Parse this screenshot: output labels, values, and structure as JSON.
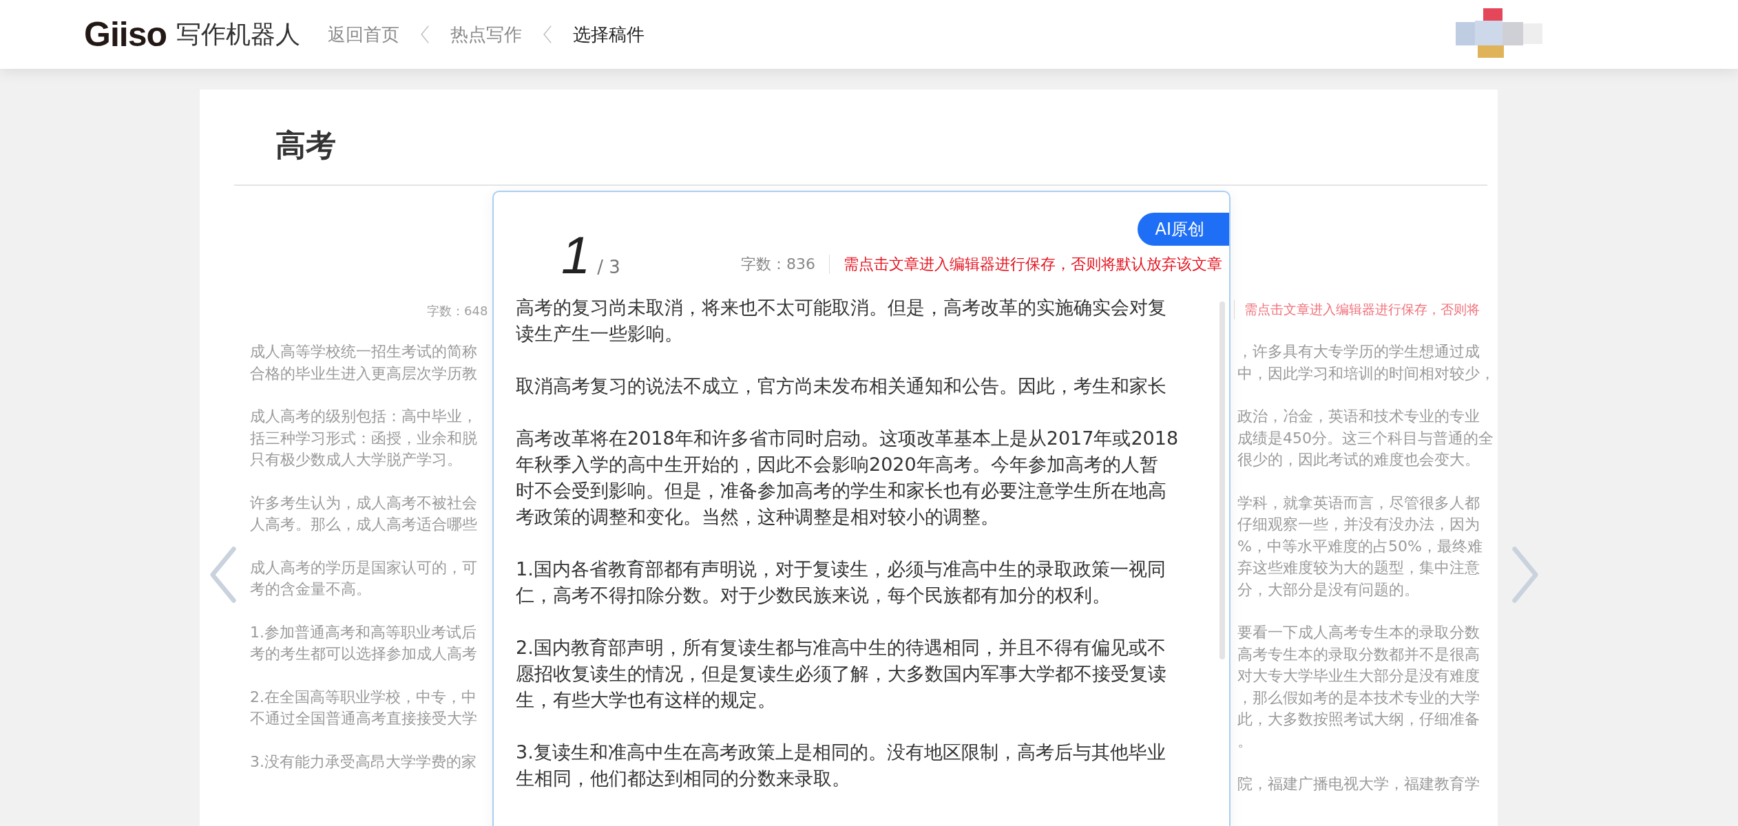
{
  "header": {
    "logo": "Giiso",
    "product": "写作机器人",
    "breadcrumbs": [
      {
        "label": "返回首页",
        "current": false
      },
      {
        "label": "热点写作",
        "current": false
      },
      {
        "label": "选择稿件",
        "current": true
      }
    ]
  },
  "background_article": {
    "title": "高考",
    "word_count": "字数：648",
    "notice": "需点击文章进入编辑器进行保存，否则将",
    "left_paragraphs": [
      [
        "成人高等学校统一招生考试的简称",
        "合格的毕业生进入更高层次学历教"
      ],
      [
        "成人高考的级别包括：高中毕业，",
        "括三种学习形式：函授，业余和脱",
        "只有极少数成人大学脱产学习。"
      ],
      [
        "许多考生认为，成人高考不被社会",
        "人高考。那么，成人高考适合哪些"
      ],
      [
        "成人高考的学历是国家认可的，可",
        "考的含金量不高。"
      ],
      [
        "1.参加普通高考和高等职业考试后",
        "考的考生都可以选择参加成人高考"
      ],
      [
        "2.在全国高等职业学校，中专，中",
        "不通过全国普通高考直接接受大学"
      ],
      [
        "3.没有能力承受高昂大学学费的家"
      ]
    ],
    "right_paragraphs": [
      [
        "，许多具有大专学历的学生想通过成",
        "中，因此学习和培训的时间相对较少，"
      ],
      [
        "政治，冶金，英语和技术专业的专业",
        "成绩是450分。这三个科目与普通的全",
        "很少的，因此考试的难度也会变大。"
      ],
      [
        "学科，就拿英语而言，尽管很多人都",
        "仔细观察一些，并没有没办法，因为",
        "%，中等水平难度的占50%，最终难",
        "弃这些难度较为大的题型，集中注意",
        "分，大部分是没有问题的。"
      ],
      [
        "要看一下成人高考专生本的录取分数",
        "高考专生本的录取分数都并不是很高",
        "对大专大学毕业生大部分是没有难度",
        "，那么假如考的是本技术专业的大学",
        "此，大多数按照考试大纲，仔细准备",
        "。"
      ],
      [
        "院，福建广播电视大学，福建教育学"
      ]
    ]
  },
  "draft_card": {
    "index": "1",
    "total": "/ 3",
    "badge": "AI原创",
    "word_count": "字数：836",
    "notice": "需点击文章进入编辑器进行保存，否则将默认放弃该文章",
    "paragraphs": [
      [
        "高考的复习尚未取消，将来也不太可能取消。但是，高考改革的实施确实会对复",
        "读生产生一些影响。"
      ],
      [
        "取消高考复习的说法不成立，官方尚未发布相关通知和公告。因此，考生和家长"
      ],
      [
        "高考改革将在2018年和许多省市同时启动。这项改革基本上是从2017年或2018",
        "年秋季入学的高中生开始的，因此不会影响2020年高考。今年参加高考的人暂",
        "时不会受到影响。但是，准备参加高考的学生和家长也有必要注意学生所在地高",
        "考政策的调整和变化。当然，这种调整是相对较小的调整。"
      ],
      [
        "1.国内各省教育部都有声明说，对于复读生，必须与准高中生的录取政策一视同",
        "仁，高考不得扣除分数。对于少数民族来说，每个民族都有加分的权利。"
      ],
      [
        "2.国内教育部声明，所有复读生都与准高中生的待遇相同，并且不得有偏见或不",
        "愿招收复读生的情况，但是复读生必须了解，大多数国内军事大学都不接受复读",
        "生，有些大学也有这样的规定。"
      ],
      [
        "3.复读生和准高中生在高考政策上是相同的。没有地区限制，高考后与其他毕业",
        "生相同，他们都达到相同的分数来录取。"
      ]
    ]
  }
}
